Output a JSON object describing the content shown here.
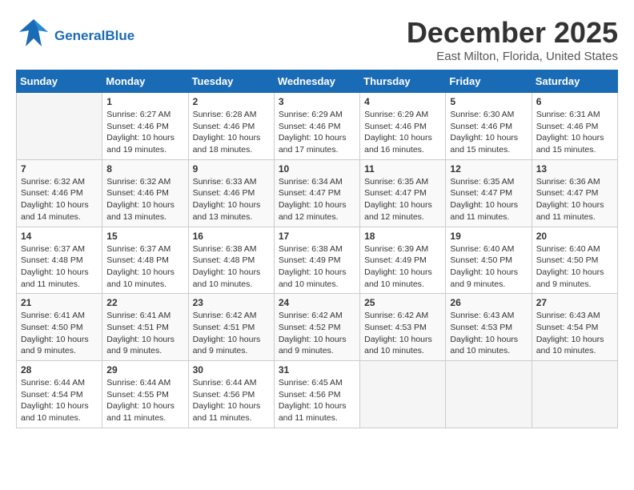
{
  "header": {
    "logo_general": "General",
    "logo_blue": "Blue",
    "main_title": "December 2025",
    "sub_title": "East Milton, Florida, United States"
  },
  "days_of_week": [
    "Sunday",
    "Monday",
    "Tuesday",
    "Wednesday",
    "Thursday",
    "Friday",
    "Saturday"
  ],
  "weeks": [
    [
      {
        "day": "",
        "info": ""
      },
      {
        "day": "1",
        "info": "Sunrise: 6:27 AM\nSunset: 4:46 PM\nDaylight: 10 hours\nand 19 minutes."
      },
      {
        "day": "2",
        "info": "Sunrise: 6:28 AM\nSunset: 4:46 PM\nDaylight: 10 hours\nand 18 minutes."
      },
      {
        "day": "3",
        "info": "Sunrise: 6:29 AM\nSunset: 4:46 PM\nDaylight: 10 hours\nand 17 minutes."
      },
      {
        "day": "4",
        "info": "Sunrise: 6:29 AM\nSunset: 4:46 PM\nDaylight: 10 hours\nand 16 minutes."
      },
      {
        "day": "5",
        "info": "Sunrise: 6:30 AM\nSunset: 4:46 PM\nDaylight: 10 hours\nand 15 minutes."
      },
      {
        "day": "6",
        "info": "Sunrise: 6:31 AM\nSunset: 4:46 PM\nDaylight: 10 hours\nand 15 minutes."
      }
    ],
    [
      {
        "day": "7",
        "info": "Sunrise: 6:32 AM\nSunset: 4:46 PM\nDaylight: 10 hours\nand 14 minutes."
      },
      {
        "day": "8",
        "info": "Sunrise: 6:32 AM\nSunset: 4:46 PM\nDaylight: 10 hours\nand 13 minutes."
      },
      {
        "day": "9",
        "info": "Sunrise: 6:33 AM\nSunset: 4:46 PM\nDaylight: 10 hours\nand 13 minutes."
      },
      {
        "day": "10",
        "info": "Sunrise: 6:34 AM\nSunset: 4:47 PM\nDaylight: 10 hours\nand 12 minutes."
      },
      {
        "day": "11",
        "info": "Sunrise: 6:35 AM\nSunset: 4:47 PM\nDaylight: 10 hours\nand 12 minutes."
      },
      {
        "day": "12",
        "info": "Sunrise: 6:35 AM\nSunset: 4:47 PM\nDaylight: 10 hours\nand 11 minutes."
      },
      {
        "day": "13",
        "info": "Sunrise: 6:36 AM\nSunset: 4:47 PM\nDaylight: 10 hours\nand 11 minutes."
      }
    ],
    [
      {
        "day": "14",
        "info": "Sunrise: 6:37 AM\nSunset: 4:48 PM\nDaylight: 10 hours\nand 11 minutes."
      },
      {
        "day": "15",
        "info": "Sunrise: 6:37 AM\nSunset: 4:48 PM\nDaylight: 10 hours\nand 10 minutes."
      },
      {
        "day": "16",
        "info": "Sunrise: 6:38 AM\nSunset: 4:48 PM\nDaylight: 10 hours\nand 10 minutes."
      },
      {
        "day": "17",
        "info": "Sunrise: 6:38 AM\nSunset: 4:49 PM\nDaylight: 10 hours\nand 10 minutes."
      },
      {
        "day": "18",
        "info": "Sunrise: 6:39 AM\nSunset: 4:49 PM\nDaylight: 10 hours\nand 10 minutes."
      },
      {
        "day": "19",
        "info": "Sunrise: 6:40 AM\nSunset: 4:50 PM\nDaylight: 10 hours\nand 9 minutes."
      },
      {
        "day": "20",
        "info": "Sunrise: 6:40 AM\nSunset: 4:50 PM\nDaylight: 10 hours\nand 9 minutes."
      }
    ],
    [
      {
        "day": "21",
        "info": "Sunrise: 6:41 AM\nSunset: 4:50 PM\nDaylight: 10 hours\nand 9 minutes."
      },
      {
        "day": "22",
        "info": "Sunrise: 6:41 AM\nSunset: 4:51 PM\nDaylight: 10 hours\nand 9 minutes."
      },
      {
        "day": "23",
        "info": "Sunrise: 6:42 AM\nSunset: 4:51 PM\nDaylight: 10 hours\nand 9 minutes."
      },
      {
        "day": "24",
        "info": "Sunrise: 6:42 AM\nSunset: 4:52 PM\nDaylight: 10 hours\nand 9 minutes."
      },
      {
        "day": "25",
        "info": "Sunrise: 6:42 AM\nSunset: 4:53 PM\nDaylight: 10 hours\nand 10 minutes."
      },
      {
        "day": "26",
        "info": "Sunrise: 6:43 AM\nSunset: 4:53 PM\nDaylight: 10 hours\nand 10 minutes."
      },
      {
        "day": "27",
        "info": "Sunrise: 6:43 AM\nSunset: 4:54 PM\nDaylight: 10 hours\nand 10 minutes."
      }
    ],
    [
      {
        "day": "28",
        "info": "Sunrise: 6:44 AM\nSunset: 4:54 PM\nDaylight: 10 hours\nand 10 minutes."
      },
      {
        "day": "29",
        "info": "Sunrise: 6:44 AM\nSunset: 4:55 PM\nDaylight: 10 hours\nand 11 minutes."
      },
      {
        "day": "30",
        "info": "Sunrise: 6:44 AM\nSunset: 4:56 PM\nDaylight: 10 hours\nand 11 minutes."
      },
      {
        "day": "31",
        "info": "Sunrise: 6:45 AM\nSunset: 4:56 PM\nDaylight: 10 hours\nand 11 minutes."
      },
      {
        "day": "",
        "info": ""
      },
      {
        "day": "",
        "info": ""
      },
      {
        "day": "",
        "info": ""
      }
    ]
  ]
}
